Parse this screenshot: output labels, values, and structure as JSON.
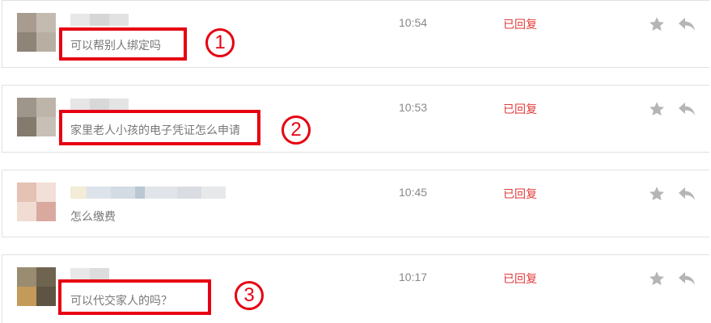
{
  "messages": [
    {
      "text": "可以帮别人绑定吗",
      "time": "10:54",
      "status": "已回复",
      "annotation": "1"
    },
    {
      "text": "家里老人小孩的电子凭证怎么申请",
      "time": "10:53",
      "status": "已回复",
      "annotation": "2"
    },
    {
      "text": "怎么缴费",
      "time": "10:45",
      "status": "已回复"
    },
    {
      "text": "可以代交家人的吗？",
      "time": "10:17",
      "status": "已回复",
      "annotation": "3"
    }
  ],
  "icons": {
    "star": "star-icon",
    "reply": "reply-arrow-icon"
  },
  "colors": {
    "status_red": "#e23a3a",
    "annotation_red": "#e60012",
    "icon_gray": "#b5b5b5"
  }
}
